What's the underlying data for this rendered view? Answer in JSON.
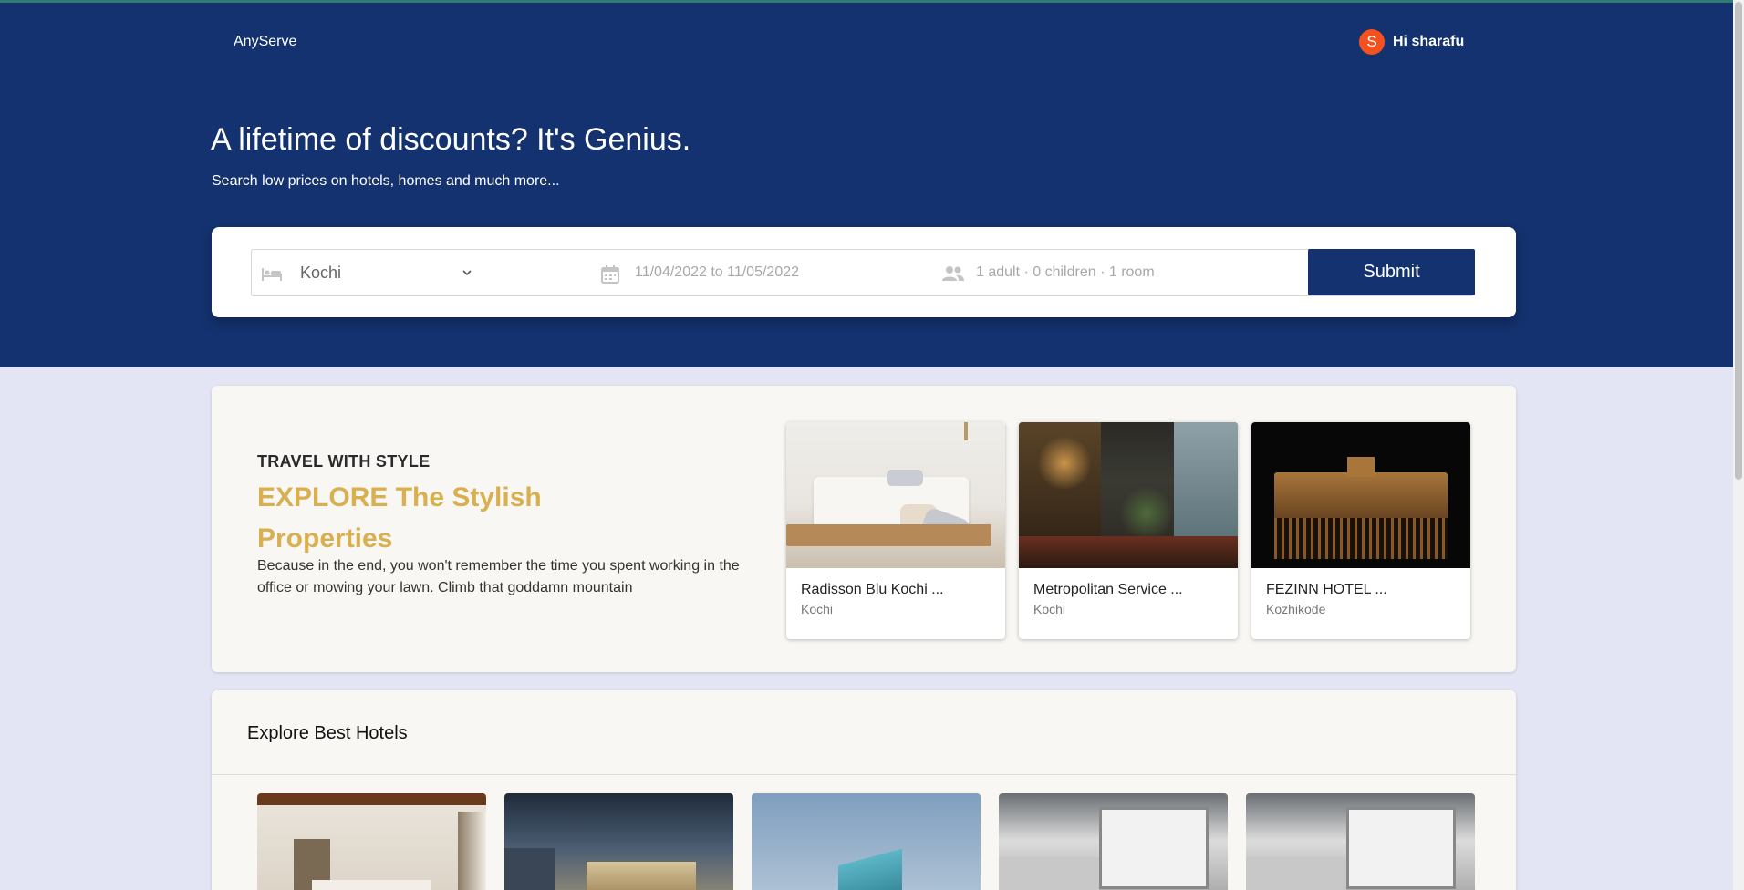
{
  "header": {
    "brand": "AnyServe",
    "user_initial": "S",
    "user_greeting": "Hi sharafu",
    "title": "A lifetime of discounts? It's Genius.",
    "subtitle": "Search low prices on hotels, homes and much more..."
  },
  "search": {
    "location": "Kochi",
    "dates": "11/04/2022 to 11/05/2022",
    "guests": "1 adult · 0 children · 1 room",
    "submit_label": "Submit"
  },
  "promo": {
    "kicker": "TRAVEL WITH STYLE",
    "title": "EXPLORE The Stylish Properties",
    "description": "Because in the end, you won't remember the time you spent working in the office or mowing your lawn. Climb that goddamn mountain",
    "cards": [
      {
        "name": "Radisson Blu Kochi ...",
        "city": "Kochi"
      },
      {
        "name": "Metropolitan Service ...",
        "city": "Kochi"
      },
      {
        "name": "FEZINN HOTEL ...",
        "city": "Kozhikode"
      }
    ]
  },
  "best": {
    "title": "Explore Best Hotels"
  },
  "colors": {
    "brand_blue": "#14326f",
    "accent_gold": "#d8b050",
    "avatar_orange": "#f4511e"
  }
}
